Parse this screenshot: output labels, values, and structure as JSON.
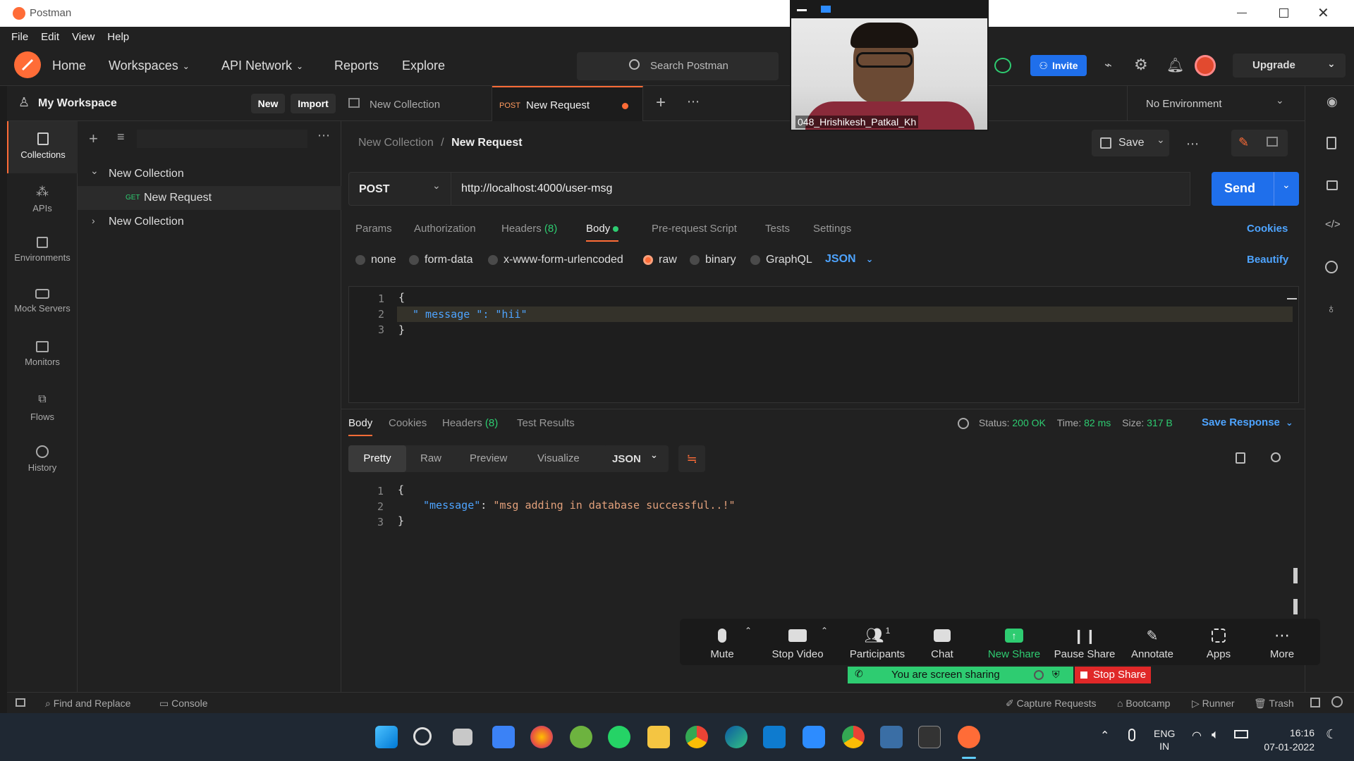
{
  "window": {
    "title": "Postman"
  },
  "menu": [
    "File",
    "Edit",
    "View",
    "Help"
  ],
  "header": {
    "nav": [
      "Home",
      "Workspaces",
      "API Network",
      "Reports",
      "Explore"
    ],
    "search_placeholder": "Search Postman",
    "invite": "Invite",
    "upgrade": "Upgrade"
  },
  "sidebar": {
    "workspace": "My Workspace",
    "new_btn": "New",
    "import_btn": "Import",
    "items": [
      "Collections",
      "APIs",
      "Environments",
      "Mock Servers",
      "Monitors",
      "Flows",
      "History"
    ]
  },
  "tree": {
    "collection1": "New Collection",
    "request_method": "GET",
    "request_name": "New Request",
    "collection2": "New Collection"
  },
  "tabs": {
    "tab1": "New Collection",
    "tab2_method": "POST",
    "tab2": "New Request",
    "environment": "No Environment"
  },
  "request": {
    "breadcrumb_parent": "New Collection",
    "breadcrumb_sep": "/",
    "breadcrumb_current": "New Request",
    "save": "Save",
    "method": "POST",
    "url": "http://localhost:4000/user-msg",
    "send": "Send",
    "tabs": [
      "Params",
      "Authorization",
      "Headers",
      "Body",
      "Pre-request Script",
      "Tests",
      "Settings"
    ],
    "headers_count": "(8)",
    "cookies": "Cookies",
    "beautify": "Beautify",
    "body_types": [
      "none",
      "form-data",
      "x-www-form-urlencoded",
      "raw",
      "binary",
      "GraphQL"
    ],
    "body_format": "JSON",
    "code_lines": [
      "{",
      "\" message \": \"hii\"",
      "}"
    ]
  },
  "response": {
    "tabs": [
      "Body",
      "Cookies",
      "Headers",
      "Test Results"
    ],
    "headers_count": "(8)",
    "status_label": "Status:",
    "status": "200 OK",
    "time_label": "Time:",
    "time": "82 ms",
    "size_label": "Size:",
    "size": "317 B",
    "save_response": "Save Response",
    "views": [
      "Pretty",
      "Raw",
      "Preview",
      "Visualize"
    ],
    "format": "JSON",
    "code_key": "\"message\"",
    "code_value": "\"msg adding in database successful..!\"",
    "open_brace": "{",
    "close_brace": "}"
  },
  "video": {
    "name": "048_Hrishikesh_Patkal_Kh"
  },
  "zoom": {
    "items": [
      "Mute",
      "Stop Video",
      "Participants",
      "Chat",
      "New Share",
      "Pause Share",
      "Annotate",
      "Apps",
      "More"
    ],
    "participants_count": "1",
    "sharing": "You are screen sharing",
    "stop_share": "Stop Share"
  },
  "statusbar": {
    "left": [
      "Find and Replace",
      "Console"
    ],
    "right": [
      "Capture Requests",
      "Bootcamp",
      "Runner",
      "Trash"
    ]
  },
  "taskbar": {
    "lang1": "ENG",
    "lang2": "IN",
    "time": "16:16",
    "date": "07-01-2022"
  },
  "colors": {
    "accent": "#ff6c37",
    "blue": "#1f6feb",
    "link": "#4ea4ff",
    "green": "#2ecc71"
  }
}
